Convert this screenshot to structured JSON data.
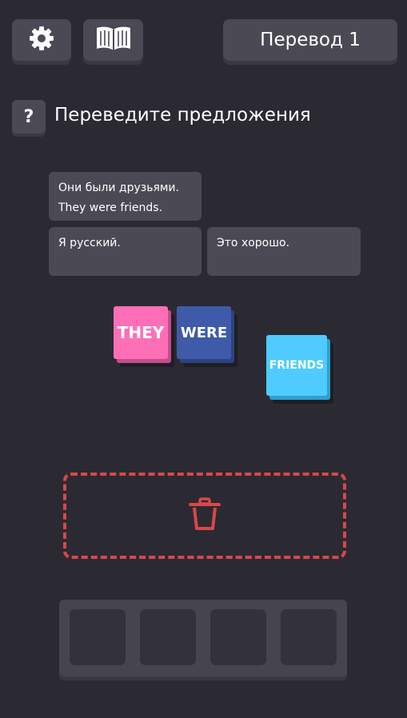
{
  "header": {
    "settings_icon": "gear-icon",
    "book_icon": "book-icon",
    "level_label": "Перевод 1"
  },
  "help": {
    "label": "?"
  },
  "instruction": "Переведите предложения",
  "cards": [
    {
      "line1": "Они были друзьями.",
      "line2": "They were friends."
    },
    {
      "line1": "Я русский.",
      "line2": ""
    },
    {
      "line1": "Это хорошо.",
      "line2": ""
    }
  ],
  "words": [
    {
      "text": "THEY",
      "color": "#ff6fb7"
    },
    {
      "text": "WERE",
      "color": "#3f5aa8"
    },
    {
      "text": "FRIENDS",
      "color": "#4fcbff"
    }
  ],
  "trash": {
    "icon": "trash-icon",
    "color": "#d9474a"
  },
  "slots_count": 4
}
